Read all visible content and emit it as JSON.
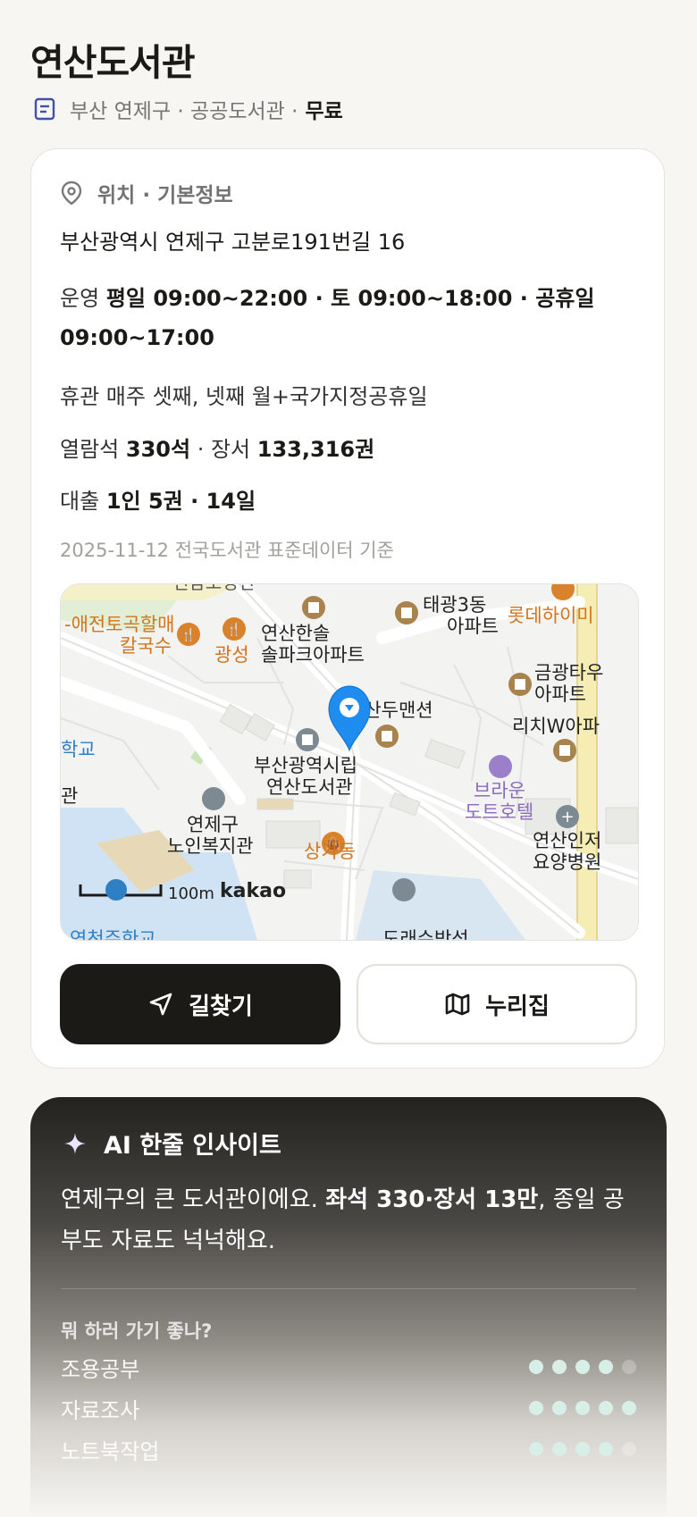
{
  "library": {
    "name": "연산도서관",
    "meta": "부산 연제구 · 공공도서관 ·",
    "fee": "무료"
  },
  "info": {
    "section_title": "위치 · 기본정보",
    "address": "부산광역시 연제구 고분로191번길 16",
    "hours_label": "운영",
    "hours_value": "평일 09:00~22:00 · 토 09:00~18:00 · 공휴일 09:00~17:00",
    "closed_text": "휴관 매주 셋째, 넷째 월+국가지정공휴일",
    "seats_label": "열람석",
    "seats_value": "330석",
    "books_label": "· 장서",
    "books_value": "133,316권",
    "loan_label": "대출",
    "loan_value": "1인 5권 · 14일",
    "basis": "2025-11-12 전국도서관 표준데이터 기준"
  },
  "map": {
    "labels": {
      "top_cut": "전남도경전",
      "aejeon": "-애전토곡할매",
      "kalguksu": "칼국수",
      "gwangseong": "광성",
      "yeonsan_hansol": "연산한솔",
      "hansol_apt": "솔파크아파트",
      "taegwang": "태광3동",
      "taegwang_apt": "아파트",
      "lotte": "롯데하이미",
      "geumgwang": "금광타우",
      "geumgwang_apt": "아파트",
      "samsandu": "삼산두맨션",
      "richi": "리치W아파",
      "school": "학교",
      "hall_cut": "관",
      "library_line1": "부산광역시립",
      "library_line2": "연산도서관",
      "brown1": "브라운",
      "brown2": "도트호텔",
      "senior1": "연제구",
      "senior2": "노인복지관",
      "sangga": "상가동",
      "hospital1": "연산인저",
      "hospital2": "요양병원",
      "scale": "100m",
      "brand": "kakao",
      "bottom_left_cut": "연천주한교",
      "bottom_right_cut": "도래수박석"
    }
  },
  "buttons": {
    "directions": "길찾기",
    "homepage": "누리집"
  },
  "ai": {
    "title": "AI 한줄 인사이트",
    "text_a": "연제구의 큰 도서관이에요. ",
    "text_bold": "좌석 330·장서 13만",
    "text_b": ", 종일 공부도 자료도 넉넉해요.",
    "question": "뭐 하러 가기 좋나?",
    "ratings": [
      {
        "label": "조용공부",
        "score": 4,
        "max": 5
      },
      {
        "label": "자료조사",
        "score": 5,
        "max": 5
      },
      {
        "label": "노트북작업",
        "score": 4,
        "max": 5
      }
    ]
  },
  "colors": {
    "primary": "#1b1a17",
    "pin": "#1f8cf0",
    "food_poi": "#d9822b",
    "building_poi": "#a8834e",
    "rating_on": "#d7efe6"
  }
}
